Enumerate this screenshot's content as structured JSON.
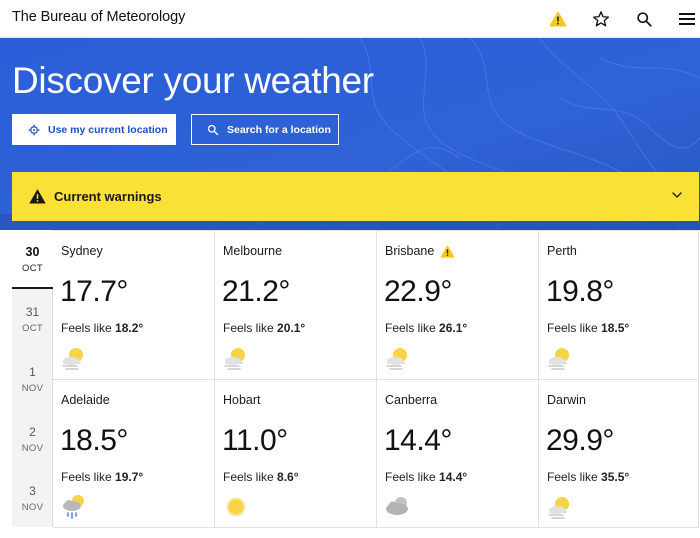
{
  "header": {
    "brand": "The Bureau of Meteorology",
    "icons": [
      "warning-icon",
      "star-icon",
      "search-icon",
      "menu-icon"
    ]
  },
  "hero": {
    "title": "Discover your weather",
    "location_button": "Use my current location",
    "search_button": "Search for a location"
  },
  "warnings": {
    "label": "Current warnings"
  },
  "days": [
    {
      "num": "30",
      "mon": "OCT",
      "active": true
    },
    {
      "num": "31",
      "mon": "OCT",
      "active": false
    },
    {
      "num": "1",
      "mon": "NOV",
      "active": false
    },
    {
      "num": "2",
      "mon": "NOV",
      "active": false
    },
    {
      "num": "3",
      "mon": "NOV",
      "active": false
    }
  ],
  "cities": [
    {
      "name": "Sydney",
      "temp": "17.7°",
      "feels_label": "Feels like",
      "feels": "18.2°",
      "icon": "mostly-sunny-icon",
      "warning": false
    },
    {
      "name": "Melbourne",
      "temp": "21.2°",
      "feels_label": "Feels like",
      "feels": "20.1°",
      "icon": "mostly-sunny-icon",
      "warning": false
    },
    {
      "name": "Brisbane",
      "temp": "22.9°",
      "feels_label": "Feels like",
      "feels": "26.1°",
      "icon": "mostly-sunny-icon",
      "warning": true
    },
    {
      "name": "Perth",
      "temp": "19.8°",
      "feels_label": "Feels like",
      "feels": "18.5°",
      "icon": "mostly-sunny-icon",
      "warning": false
    },
    {
      "name": "Adelaide",
      "temp": "18.5°",
      "feels_label": "Feels like",
      "feels": "19.7°",
      "icon": "showers-icon",
      "warning": false
    },
    {
      "name": "Hobart",
      "temp": "11.0°",
      "feels_label": "Feels like",
      "feels": "8.6°",
      "icon": "sunny-icon",
      "warning": false
    },
    {
      "name": "Canberra",
      "temp": "14.4°",
      "feels_label": "Feels like",
      "feels": "14.4°",
      "icon": "cloudy-icon",
      "warning": false
    },
    {
      "name": "Darwin",
      "temp": "29.9°",
      "feels_label": "Feels like",
      "feels": "35.5°",
      "icon": "mostly-sunny-icon",
      "warning": false
    }
  ],
  "colors": {
    "hero_blue": "#2d5fd6",
    "warning_yellow": "#fbe036",
    "link_blue": "#1e4fbf"
  }
}
